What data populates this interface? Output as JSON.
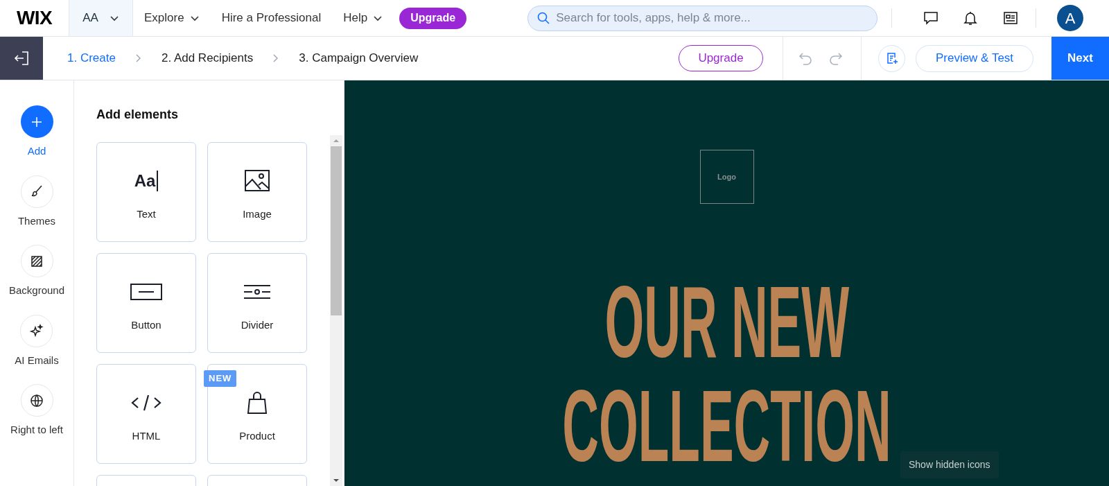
{
  "top_nav": {
    "logo": "WIX",
    "site": "AA",
    "menu": [
      {
        "label": "Explore",
        "has_menu": true
      },
      {
        "label": "Hire a Professional",
        "has_menu": false
      },
      {
        "label": "Help",
        "has_menu": true
      }
    ],
    "upgrade": "Upgrade",
    "search": {
      "placeholder": "Search for tools, apps, help & more..."
    },
    "avatar": "A"
  },
  "steps": [
    {
      "label": "1. Create",
      "selected": true
    },
    {
      "label": "2. Add Recipients",
      "selected": false
    },
    {
      "label": "3. Campaign Overview",
      "selected": false
    }
  ],
  "upgrade": "Upgrade",
  "preview": "Preview & Test",
  "next": "Next",
  "rail": [
    {
      "kind": "add",
      "label": "Add",
      "selected": true
    },
    {
      "kind": "themes",
      "label": "Themes",
      "selected": false
    },
    {
      "kind": "background",
      "label": "Background",
      "selected": false
    },
    {
      "kind": "ai",
      "label": "AI Emails",
      "selected": false
    },
    {
      "kind": "rtl",
      "label": "Right to left",
      "selected": false
    }
  ],
  "panel": {
    "title": "Add elements",
    "element_rows": [
      [
        {
          "kind": "text",
          "label": "Text",
          "glyph": "Aa"
        },
        {
          "kind": "image",
          "label": "Image"
        }
      ],
      [
        {
          "kind": "button",
          "label": "Button"
        },
        {
          "kind": "divider",
          "label": "Divider"
        }
      ],
      [
        {
          "kind": "html",
          "label": "HTML"
        },
        {
          "kind": "product",
          "label": "Product",
          "badge": "NEW"
        }
      ]
    ]
  },
  "canvas": {
    "logo": "Logo",
    "headline": [
      "OUR NEW",
      "COLLECTION"
    ]
  },
  "tooltip": "Show hidden icons"
}
